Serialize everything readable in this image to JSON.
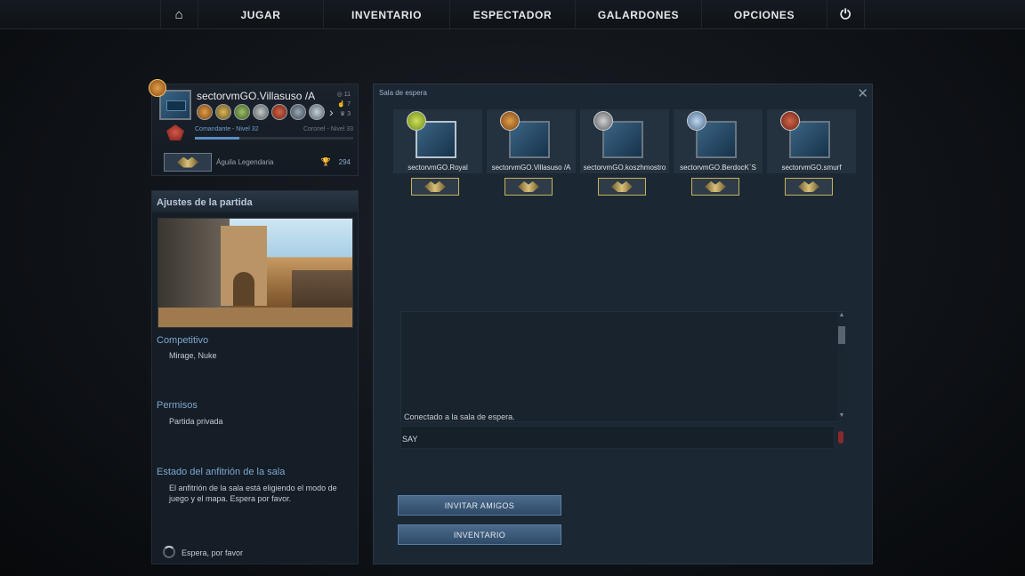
{
  "nav": {
    "home_icon": "home-icon",
    "items": [
      "JUGAR",
      "INVENTARIO",
      "ESPECTADOR",
      "GALARDONES",
      "OPCIONES"
    ],
    "power_icon": "power-icon"
  },
  "profile": {
    "name": "sectorvmGO.Villasuso /A",
    "stats": [
      "11",
      "7",
      "3"
    ],
    "rank_left": "Comandante - Nivel 32",
    "rank_right": "Coronel - Nivel 33",
    "xp_fraction": 0.28,
    "skill_group": "Águila Legendaria",
    "trophy_count": "294"
  },
  "settings": {
    "title": "Ajustes de la partida",
    "mode_title": "Competitivo",
    "mode_maps": "Mirage, Nuke",
    "perm_title": "Permisos",
    "perm_value": "Partida privada",
    "host_title": "Estado del anfitrión de la sala",
    "host_text": "El anfitrión de la sala está eligiendo el modo de juego y el mapa. Espera por favor.",
    "wait_text": "Espera, por favor"
  },
  "lobby": {
    "title": "Sala de espera",
    "players": [
      {
        "name": "sectorvmGO.Royal"
      },
      {
        "name": "sectorvmGO.Villasuso /A"
      },
      {
        "name": "sectorvmGO.koszhmostro"
      },
      {
        "name": "sectorvmGO.BerdocK`S"
      },
      {
        "name": "sectorvmGO.smurf"
      }
    ],
    "chat_message": "Conectado a la sala de espera.",
    "say_placeholder": "SAY",
    "invite_button": "INVITAR AMIGOS",
    "inventory_button": "INVENTARIO"
  }
}
